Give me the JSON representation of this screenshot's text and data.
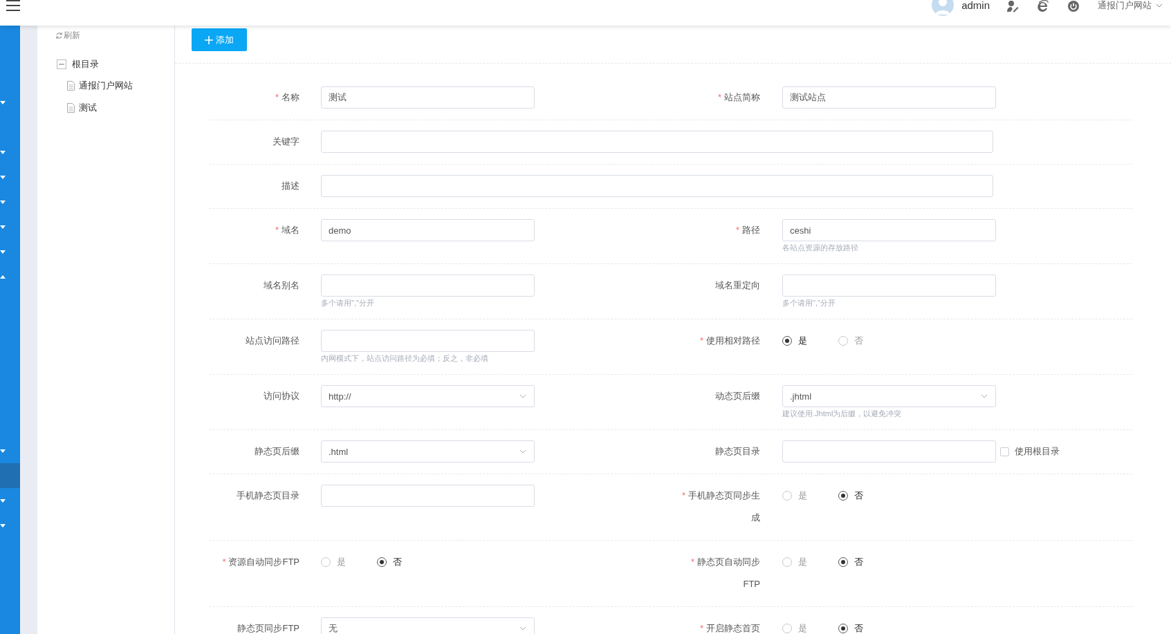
{
  "header": {
    "user": "admin",
    "site_switcher": "通报门户网站"
  },
  "sidebar": {
    "items": [
      {
        "kind": "folder",
        "expanded": false,
        "selected": false
      },
      {
        "kind": "link",
        "selected": false
      },
      {
        "kind": "folder",
        "expanded": false,
        "selected": false
      },
      {
        "kind": "folder",
        "expanded": false,
        "selected": false
      },
      {
        "kind": "folder",
        "expanded": false,
        "selected": false
      },
      {
        "kind": "folder",
        "expanded": false,
        "selected": false
      },
      {
        "kind": "folder",
        "expanded": false,
        "selected": false
      },
      {
        "kind": "folder",
        "expanded": true,
        "selected": false
      },
      {
        "kind": "link",
        "selected": false
      },
      {
        "kind": "link",
        "selected": false
      },
      {
        "kind": "link",
        "selected": false
      },
      {
        "kind": "link",
        "selected": false
      },
      {
        "kind": "link",
        "selected": false
      },
      {
        "kind": "link",
        "selected": false
      },
      {
        "kind": "folder",
        "expanded": false,
        "selected": false
      },
      {
        "kind": "link",
        "selected": true
      },
      {
        "kind": "folder",
        "expanded": false,
        "selected": false
      },
      {
        "kind": "folder",
        "expanded": false,
        "selected": false
      }
    ]
  },
  "tree": {
    "refresh": "刷新",
    "root": {
      "label": "根目录",
      "expanded": true,
      "children": [
        {
          "label": "通报门户网站"
        },
        {
          "label": "测试"
        }
      ]
    }
  },
  "toolbar": {
    "add_button": "添加"
  },
  "form": {
    "rows": [
      {
        "fields": [
          {
            "kind": "input",
            "label": "名称",
            "required_mark": "*",
            "value": "测试"
          },
          {
            "kind": "input",
            "label": "站点简称",
            "required_mark": "*",
            "value": "测试站点"
          }
        ]
      },
      {
        "fields": [
          {
            "kind": "wide_input",
            "label": "关键字"
          }
        ]
      },
      {
        "fields": [
          {
            "kind": "wide_input",
            "label": "描述"
          }
        ]
      },
      {
        "fields": [
          {
            "kind": "input",
            "label": "域名",
            "required_mark": "*",
            "value": "demo"
          },
          {
            "kind": "input",
            "label": "路径",
            "required_mark": "*",
            "value": "ceshi",
            "hint": "各站点资源的存放路径"
          }
        ]
      },
      {
        "fields": [
          {
            "kind": "input",
            "label": "域名别名",
            "hint": "多个请用\",\"分开"
          },
          {
            "kind": "input",
            "label": "域名重定向",
            "hint": "多个请用\",\"分开"
          }
        ]
      },
      {
        "fields": [
          {
            "kind": "input",
            "label": "站点访问路径",
            "hint": "内网模式下，站点访问路径为必填；反之，非必填"
          },
          {
            "kind": "radio",
            "label": "使用相对路径",
            "required_mark": "*",
            "options": [
              {
                "label": "是",
                "selected": true
              },
              {
                "label": "否",
                "selected": false
              }
            ]
          }
        ]
      },
      {
        "fields": [
          {
            "kind": "select",
            "label": "访问协议",
            "value": "http://"
          },
          {
            "kind": "select",
            "label": "动态页后缀",
            "value": ".jhtml",
            "hint": "建议使用.Jhtml为后缀，以避免冲突"
          }
        ]
      },
      {
        "fields": [
          {
            "kind": "select",
            "label": "静态页后缀",
            "value": ".html"
          },
          {
            "kind": "input",
            "label": "静态页目录",
            "checkbox": {
              "label": "使用根目录",
              "checked": false
            }
          }
        ]
      },
      {
        "fields": [
          {
            "kind": "input",
            "label": "手机静态页目录"
          },
          {
            "kind": "radio",
            "label": "手机静态页同步生成",
            "required_mark": "*",
            "options": [
              {
                "label": "是",
                "selected": false
              },
              {
                "label": "否",
                "selected": true
              }
            ]
          }
        ]
      },
      {
        "fields": [
          {
            "kind": "radio",
            "label": "资源自动同步FTP",
            "required_mark": "*",
            "options": [
              {
                "label": "是",
                "selected": false
              },
              {
                "label": "否",
                "selected": true
              }
            ]
          },
          {
            "kind": "radio",
            "label": "静态页自动同步FTP",
            "required_mark": "*",
            "options": [
              {
                "label": "是",
                "selected": false
              },
              {
                "label": "否",
                "selected": true
              }
            ]
          }
        ]
      },
      {
        "fields": [
          {
            "kind": "select",
            "label": "静态页同步FTP",
            "value": "无"
          },
          {
            "kind": "radio",
            "label": "开启静态首页",
            "required_mark": "*",
            "options": [
              {
                "label": "是",
                "selected": false
              },
              {
                "label": "否",
                "selected": true
              }
            ]
          }
        ]
      }
    ]
  }
}
